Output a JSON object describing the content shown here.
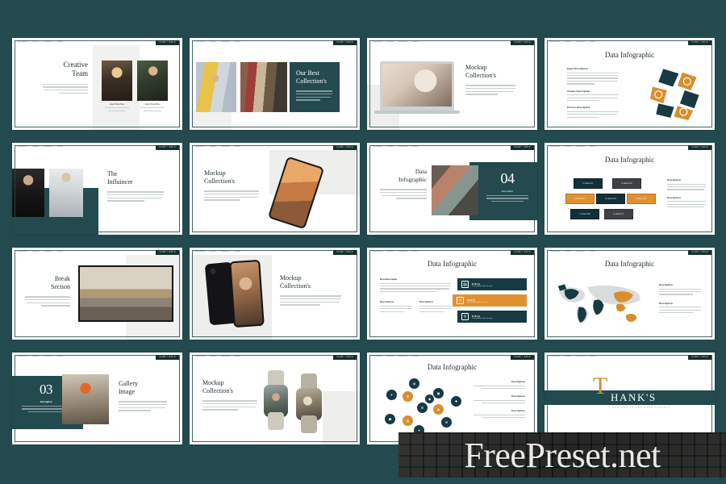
{
  "page": {
    "background_color": "#234a4e",
    "accent_teal": "#123038",
    "accent_gold": "#e0912f",
    "accent_gray": "#3f4244",
    "grid": {
      "columns": 4,
      "rows": 4,
      "slide_count": 16
    }
  },
  "watermark": {
    "text": "FreePreset.net"
  },
  "slide_badge": "SLIDE • DECK",
  "slides": [
    {
      "index": 1,
      "name": "creative-team",
      "title_lines": [
        "Creative",
        "Team"
      ],
      "body_line_count": 4,
      "captions": [
        {
          "name": "Insert Name Here",
          "role": "Description"
        },
        {
          "name": "Insert Name Here",
          "role": "Description"
        }
      ]
    },
    {
      "index": 2,
      "name": "our-best-collections",
      "title_lines": [
        "Our Best",
        "Collection's"
      ],
      "body_line_count": 4
    },
    {
      "index": 3,
      "name": "mockup-collections-laptop",
      "title_lines": [
        "Mockup",
        "Collection's"
      ],
      "body_line_count": 4
    },
    {
      "index": 4,
      "name": "data-infographic-recycle",
      "title": "Data Infographic",
      "sections": [
        {
          "heading": "Input Description",
          "line_count": 5
        },
        {
          "heading": "Output Description",
          "line_count": 3
        },
        {
          "heading": "Process Description",
          "line_count": 3
        }
      ],
      "diagram": "recycle-arrows"
    },
    {
      "index": 5,
      "name": "the-influincer",
      "title_lines": [
        "The",
        "Influincer"
      ],
      "body_line_count": 4
    },
    {
      "index": 6,
      "name": "mockup-collections-phone-tilt",
      "title_lines": [
        "Mockup",
        "Collection's"
      ],
      "body_line_count": 4
    },
    {
      "index": 7,
      "name": "data-infographic-04",
      "title_lines": [
        "Data",
        "Infographic"
      ],
      "body_line_count": 4,
      "number": "04",
      "number_caption": "Description",
      "number_line_count": 3
    },
    {
      "index": 8,
      "name": "data-infographic-boxes",
      "title": "Data Infographic",
      "boxes": [
        {
          "label": "Content 01",
          "color": "teal"
        },
        {
          "label": "Content 02",
          "color": "gray"
        },
        {
          "label": "Content 03",
          "color": "gold"
        },
        {
          "label": "Content 04",
          "color": "teal"
        },
        {
          "label": "Content 05",
          "color": "gold"
        },
        {
          "label": "Content 06",
          "color": "teal"
        },
        {
          "label": "Content 07",
          "color": "gray"
        }
      ],
      "sections": [
        {
          "heading": "Description",
          "line_count": 3
        },
        {
          "heading": "Description",
          "line_count": 3
        }
      ]
    },
    {
      "index": 9,
      "name": "break-section",
      "title_lines": [
        "Break",
        "Section"
      ],
      "body_line_count": 4
    },
    {
      "index": 10,
      "name": "mockup-collections-phone-pair",
      "title_lines": [
        "Mockup",
        "Collection's"
      ],
      "body_line_count": 4
    },
    {
      "index": 11,
      "name": "data-infographic-revenue",
      "title": "Data Infographic",
      "sections": [
        {
          "heading": "Revenue Input",
          "line_count": 4
        },
        {
          "heading": "Description",
          "line_count": 3
        },
        {
          "heading": "Description",
          "line_count": 3
        }
      ],
      "bars": [
        {
          "label": "$1.87 pt",
          "sub": "Consectetur dolor sit amet",
          "icon": "briefcase-icon",
          "color": "teal"
        },
        {
          "label": "$1.87 pt",
          "sub": "Consectetur dolor sit amet",
          "icon": "clock-icon",
          "color": "gold"
        },
        {
          "label": "$1.87 pt",
          "sub": "Consectetur dolor sit amet",
          "icon": "pin-icon",
          "color": "teal"
        }
      ]
    },
    {
      "index": 12,
      "name": "data-infographic-world-map",
      "title": "Data Infographic",
      "sections": [
        {
          "heading": "Description",
          "line_count": 3
        },
        {
          "heading": "Description",
          "line_count": 3
        }
      ],
      "map_regions": [
        {
          "region": "North America",
          "color": "teal"
        },
        {
          "region": "South America",
          "color": "teal"
        },
        {
          "region": "Africa",
          "color": "teal"
        },
        {
          "region": "Asia",
          "color": "gold"
        },
        {
          "region": "Australia",
          "color": "gold"
        }
      ]
    },
    {
      "index": 13,
      "name": "gallery-image-03",
      "number": "03",
      "number_caption": "Description",
      "number_line_count": 3,
      "title_lines": [
        "Gallery",
        "Image"
      ],
      "body_line_count": 4
    },
    {
      "index": 14,
      "name": "mockup-collections-watch",
      "title_lines": [
        "Mockup",
        "Collection's"
      ],
      "body_line_count": 4
    },
    {
      "index": 15,
      "name": "data-infographic-nodes",
      "title": "Data Infographic",
      "node_count": 12,
      "sections": [
        {
          "heading": "Description",
          "line_count": 2
        },
        {
          "heading": "Description",
          "line_count": 2
        },
        {
          "heading": "Description",
          "line_count": 2
        }
      ]
    },
    {
      "index": 16,
      "name": "thanks-closing",
      "drop_cap": "T",
      "title": "HANK'S",
      "subtitle": "SEE YOU IN THE NEXT PROJECT"
    }
  ]
}
